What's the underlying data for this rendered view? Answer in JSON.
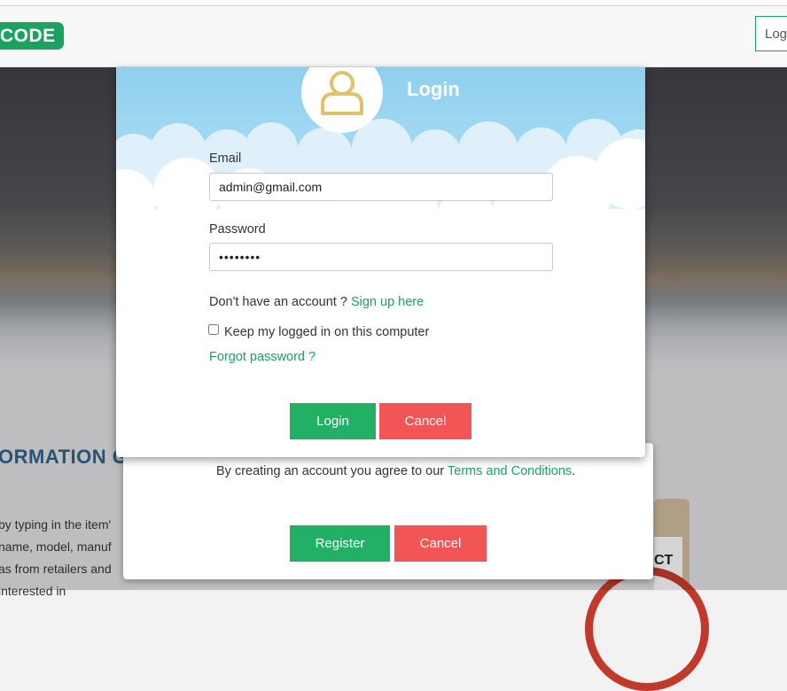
{
  "navbar": {
    "logo": "CODE",
    "login_button": "Log"
  },
  "background": {
    "heading": "ORMATION G",
    "para_lines": [
      "by typing in the item'",
      "name, model, manuf",
      "as from retailers and",
      "interested in"
    ],
    "card_text": "CT"
  },
  "register_modal": {
    "terms_prefix": "By creating an account you agree to our ",
    "terms_link": "Terms and Conditions",
    "terms_suffix": ".",
    "register_button": "Register",
    "cancel_button": "Cancel"
  },
  "login_modal": {
    "title": "Login",
    "email_label": "Email",
    "email_value": "admin@gmail.com",
    "password_label": "Password",
    "password_value": "••••••••",
    "no_account_text": "Don't have an account ? ",
    "signup_link": "Sign up here",
    "keep_logged_label": "Keep my logged in on this computer",
    "forgot_link": "Forgot password ?",
    "login_button": "Login",
    "cancel_button": "Cancel"
  },
  "colors": {
    "accent": "#1aa260",
    "danger": "#f25555",
    "sky": "#8fd0ee"
  }
}
